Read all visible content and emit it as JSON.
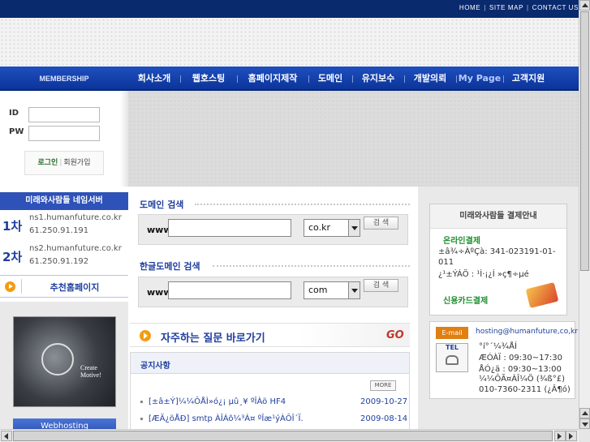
{
  "top_links": [
    "HOME",
    "SITE MAP",
    "CONTACT US"
  ],
  "nav": {
    "membership_label": "MEMBERSHIP",
    "menu": [
      {
        "label": "회사소개",
        "w": 64
      },
      {
        "label": "웹호스팅",
        "w": 70
      },
      {
        "label": "홈페이지제작",
        "w": 88
      },
      {
        "label": "도메인",
        "w": 54
      },
      {
        "label": "유지보수",
        "w": 64
      },
      {
        "label": "개발의뢰",
        "w": 64
      },
      {
        "label": "My Page",
        "w": 58,
        "highlight": true
      },
      {
        "label": "고객지원",
        "w": 62
      }
    ]
  },
  "login": {
    "id_label": "ID",
    "pw_label": "PW",
    "login_label": "로그인",
    "join_label": "회원가입"
  },
  "nameserver": {
    "title": "미래와사람들 네임서버",
    "primary": {
      "num": "1차",
      "host": "ns1.humanfuture.co.kr",
      "ip": "61.250.91.191"
    },
    "secondary": {
      "num": "2차",
      "host": "ns2.humanfuture.co.kr",
      "ip": "61.250.91.192"
    }
  },
  "recommend_label": "추천홈페이지",
  "banner": {
    "title": "Create Motive!",
    "button": "Webhosting"
  },
  "domain_search": {
    "title": "도메인 검색",
    "www": "www",
    "tld": "co.kr",
    "button": "검 색"
  },
  "kr_domain_search": {
    "title": "한글도메인 검색",
    "www": "www",
    "tld": "com",
    "button": "검 색"
  },
  "faq": {
    "label": "자주하는 질문 바로가기",
    "go": "GO"
  },
  "notice": {
    "title": "공지사항",
    "more": "MORE",
    "items": [
      {
        "title": "[±â±Ý]¼¼ÔÅÌ»ó¿¡ µû¸¥ ºÎÀö HF4",
        "date": "2009-10-27"
      },
      {
        "title": "[ÆÄ¿öÅÐ] smtp ÀÎÁõ¼³Á¤ ºÎæ¹ýÀÔÎ´Ï.",
        "date": "2009-08-14"
      }
    ]
  },
  "payment": {
    "title": "미래와사람들 결제안내",
    "online_label": "온라인결제",
    "account": "±â¾÷ÀºÇà: 341-023191-01-011",
    "holder": "¿¹±ÝÁÖ : ¹Ì·¡¿Í »ç¶÷µé",
    "card_label": "신용카드결제"
  },
  "contact": {
    "email_label": "E-mail",
    "email": "hosting@humanfuture,co,kr",
    "tel_label": "TEL",
    "line1": "°í°´¼¾ÅÍ",
    "line2": "ÆÓÀÏ : 09:30~17:30",
    "line3": "ÅÓ¿ä : 09:30~13:00",
    "line4": "¼¼ÔÃ¤ÀÎ¼Ö (¾ß°£)",
    "line5": "010-7360-2311 (¿Â¶ó)"
  },
  "colors": {
    "nav_blue": "#0c349a",
    "top_bar": "#0a2a6e",
    "accent_orange": "#f39c12",
    "green": "#1e8f2e"
  }
}
